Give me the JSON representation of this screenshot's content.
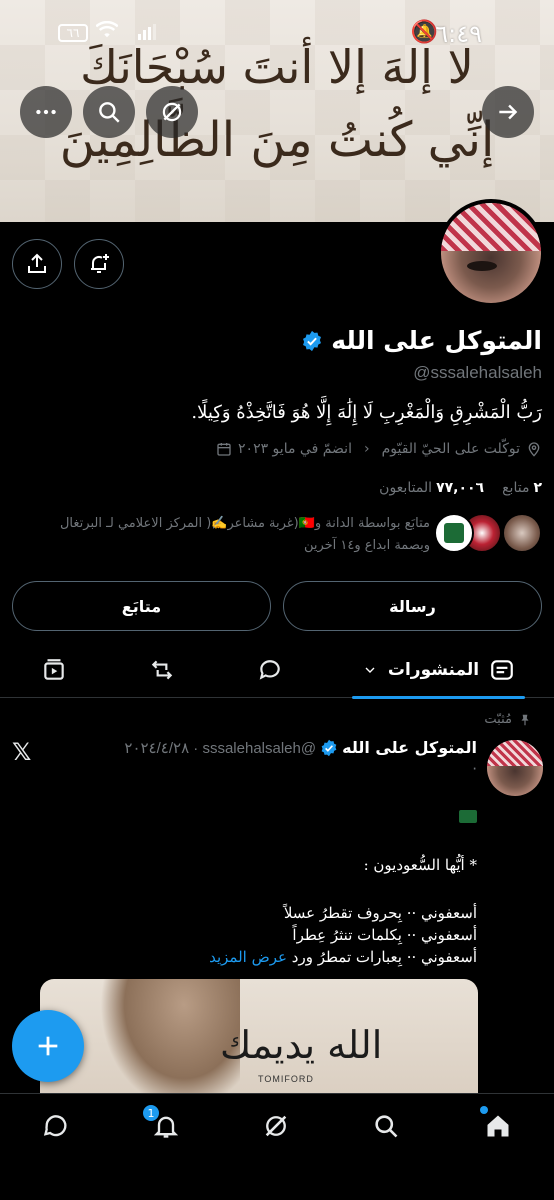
{
  "status_bar": {
    "time": "٦:٤٩",
    "battery": "٦٦"
  },
  "banner": {
    "line1": "لا إلهَ إلا أنتَ سُبْحَانَكَ",
    "line2": "إنِّي كُنتُ مِنَ الظَّالِمِينَ"
  },
  "profile": {
    "name": "المتوكل على الله",
    "handle": "@sssalehalsaleh",
    "bio": "رَبُّ الْمَشْرِقِ وَالْمَغْرِبِ لَا إِلَٰهَ إِلَّا هُوَ فَاتَّخِذْهُ وَكِيلًا.",
    "location": "توكّلت على الحيّ القيّوم",
    "joined": "انضمّ في مايو ٢٠٢٣",
    "following_count": "٢",
    "following_label": "متابع",
    "followers_count": "٧٧,٠٠٦",
    "followers_label": "المتابعون",
    "followed_by_line1": "متابَع بواسطة الدانة و🇵🇹(غربة مشاعر✍️( المركز الاعلامي لـ البرتغال",
    "followed_by_line2": "وبصمة ابداع و١٤ آخرين"
  },
  "actions": {
    "message": "رسالة",
    "following": "متابَع"
  },
  "tabs": {
    "posts": "المنشورات"
  },
  "tweet": {
    "pinned_label": "مُثبّت",
    "author": "المتوكل على الله",
    "handle_date": "@sssalehalsaleh · ٢٠٢٤/٤/٢٨",
    "dot": "·",
    "line1": "* أيُّها السُّعوديون :",
    "line2": "أسعفوني ·· بِحروف تقطرُ عسلاً",
    "line3": "أسعفوني ·· بِكلمات تنثرُ عِطراً",
    "line4_prefix": "أسعفوني ·· بِعبارات تمطرُ ورد",
    "show_more": "عرض المزيد",
    "media_script": "الله يديمك",
    "media_brand": "TOMIFORD"
  },
  "bottom_nav": {
    "notifications_badge": "1"
  },
  "colors": {
    "accent": "#1d9bf0",
    "background": "#000000",
    "muted": "#71767b"
  }
}
